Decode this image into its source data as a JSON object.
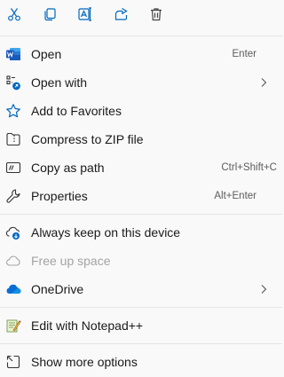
{
  "actions": [
    {
      "name": "cut",
      "icon": "scissors-icon"
    },
    {
      "name": "copy",
      "icon": "copy-icon"
    },
    {
      "name": "rename",
      "icon": "rename-icon"
    },
    {
      "name": "share",
      "icon": "share-icon"
    },
    {
      "name": "delete",
      "icon": "trash-icon"
    }
  ],
  "items": {
    "open": {
      "label": "Open",
      "shortcut": "Enter",
      "icon": "word-app-icon"
    },
    "open_with": {
      "label": "Open with",
      "icon": "open-with-icon",
      "has_submenu": true
    },
    "favorites": {
      "label": "Add to Favorites",
      "icon": "star-icon"
    },
    "zip": {
      "label": "Compress to ZIP file",
      "icon": "zip-icon"
    },
    "copy_path": {
      "label": "Copy as path",
      "shortcut": "Ctrl+Shift+C",
      "icon": "copy-path-icon"
    },
    "properties": {
      "label": "Properties",
      "shortcut": "Alt+Enter",
      "icon": "wrench-icon"
    },
    "keep": {
      "label": "Always keep on this device",
      "icon": "cloud-sync-icon"
    },
    "free": {
      "label": "Free up space",
      "icon": "cloud-outline-icon",
      "disabled": true
    },
    "onedrive": {
      "label": "OneDrive",
      "icon": "onedrive-icon",
      "has_submenu": true
    },
    "notepad": {
      "label": "Edit with Notepad++",
      "icon": "notepad-plus-icon"
    },
    "more": {
      "label": "Show more options",
      "icon": "show-more-icon"
    }
  },
  "colors": {
    "accent": "#0067c0",
    "word_blue": "#185abd",
    "onedrive_blue": "#0a6cd5",
    "disabled_text": "#a3a3a3"
  }
}
